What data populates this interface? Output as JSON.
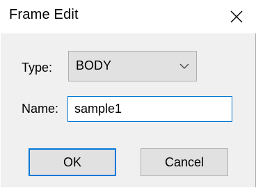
{
  "window": {
    "title": "Frame Edit",
    "close_icon": "close-icon"
  },
  "form": {
    "type_label": "Type:",
    "type_value": "BODY",
    "type_dropdown_icon": "chevron-down-icon",
    "name_label": "Name:",
    "name_value": "sample1"
  },
  "buttons": {
    "ok_label": "OK",
    "cancel_label": "Cancel"
  },
  "colors": {
    "accent": "#0078d7",
    "button_bg": "#e1e1e1",
    "dialog_bg": "#f0f0f0"
  }
}
